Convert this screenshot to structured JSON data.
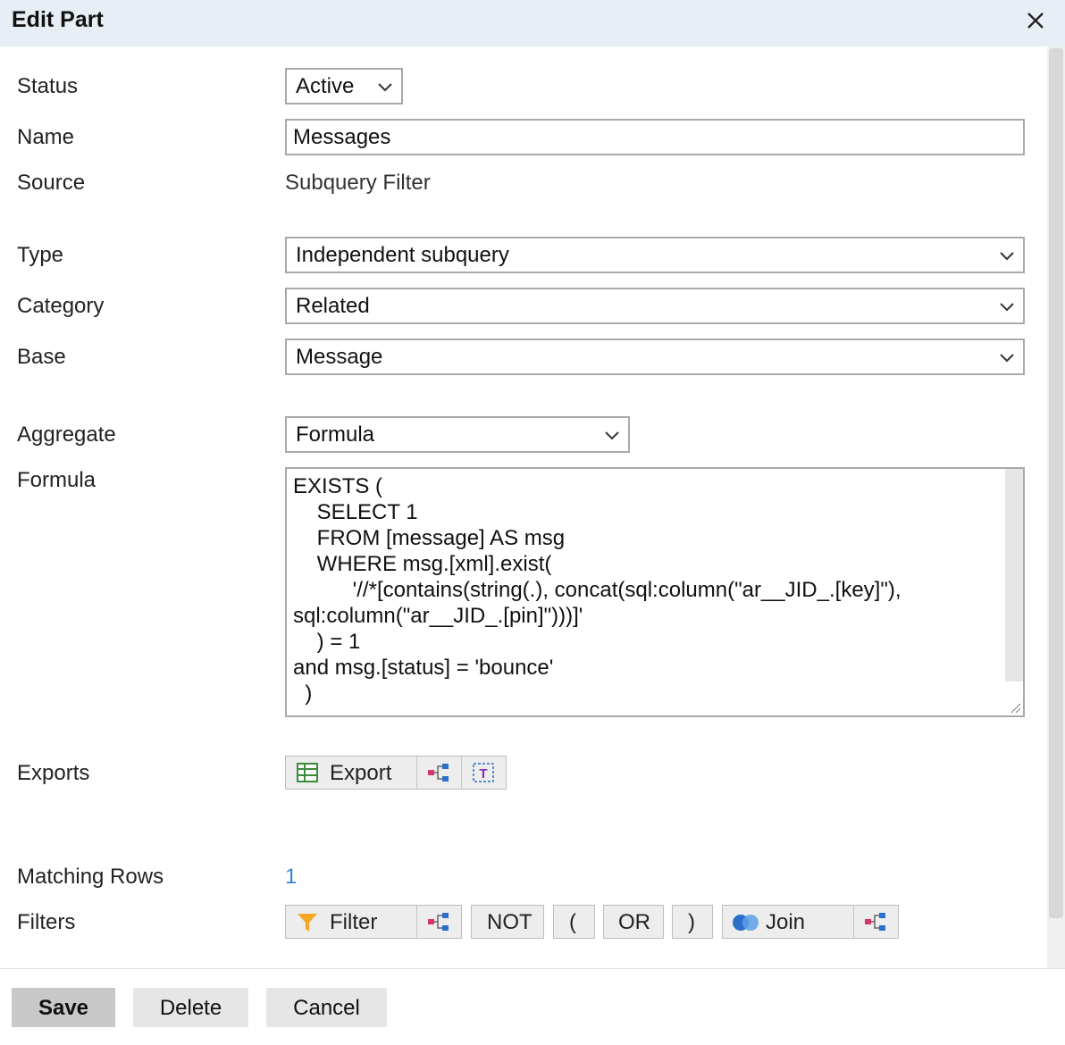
{
  "dialog": {
    "title": "Edit Part",
    "close_icon": "close-icon"
  },
  "fields": {
    "status": {
      "label": "Status",
      "value": "Active"
    },
    "name": {
      "label": "Name",
      "value": "Messages"
    },
    "source": {
      "label": "Source",
      "value": "Subquery Filter"
    },
    "type": {
      "label": "Type",
      "value": "Independent subquery"
    },
    "category": {
      "label": "Category",
      "value": "Related"
    },
    "base": {
      "label": "Base",
      "value": "Message"
    },
    "aggregate": {
      "label": "Aggregate",
      "value": "Formula"
    },
    "formula": {
      "label": "Formula",
      "value": "EXISTS (\n\tSELECT 1\n\tFROM [message] AS msg\n\tWHERE msg.[xml].exist(\n\t      '//*[contains(string(.), concat(sql:column(\"ar__JID_.[key]\"), sql:column(\"ar__JID_.[pin]\")))]'\n\t) = 1\nand msg.[status] = 'bounce'\n  )"
    },
    "exports": {
      "label": "Exports",
      "export_button": "Export"
    },
    "matching_rows": {
      "label": "Matching Rows",
      "value": "1"
    },
    "filters": {
      "label": "Filters",
      "filter_button": "Filter",
      "not_button": "NOT",
      "open_paren_button": "(",
      "or_button": "OR",
      "close_paren_button": ")",
      "join_button": "Join"
    }
  },
  "footer": {
    "save": "Save",
    "delete": "Delete",
    "cancel": "Cancel"
  },
  "colors": {
    "titlebar": "#e8eef5",
    "link": "#3a86d8",
    "filter_icon": "#f5a623",
    "join_icon": "#2a6fc9",
    "tree_icon": "#d6336c"
  }
}
